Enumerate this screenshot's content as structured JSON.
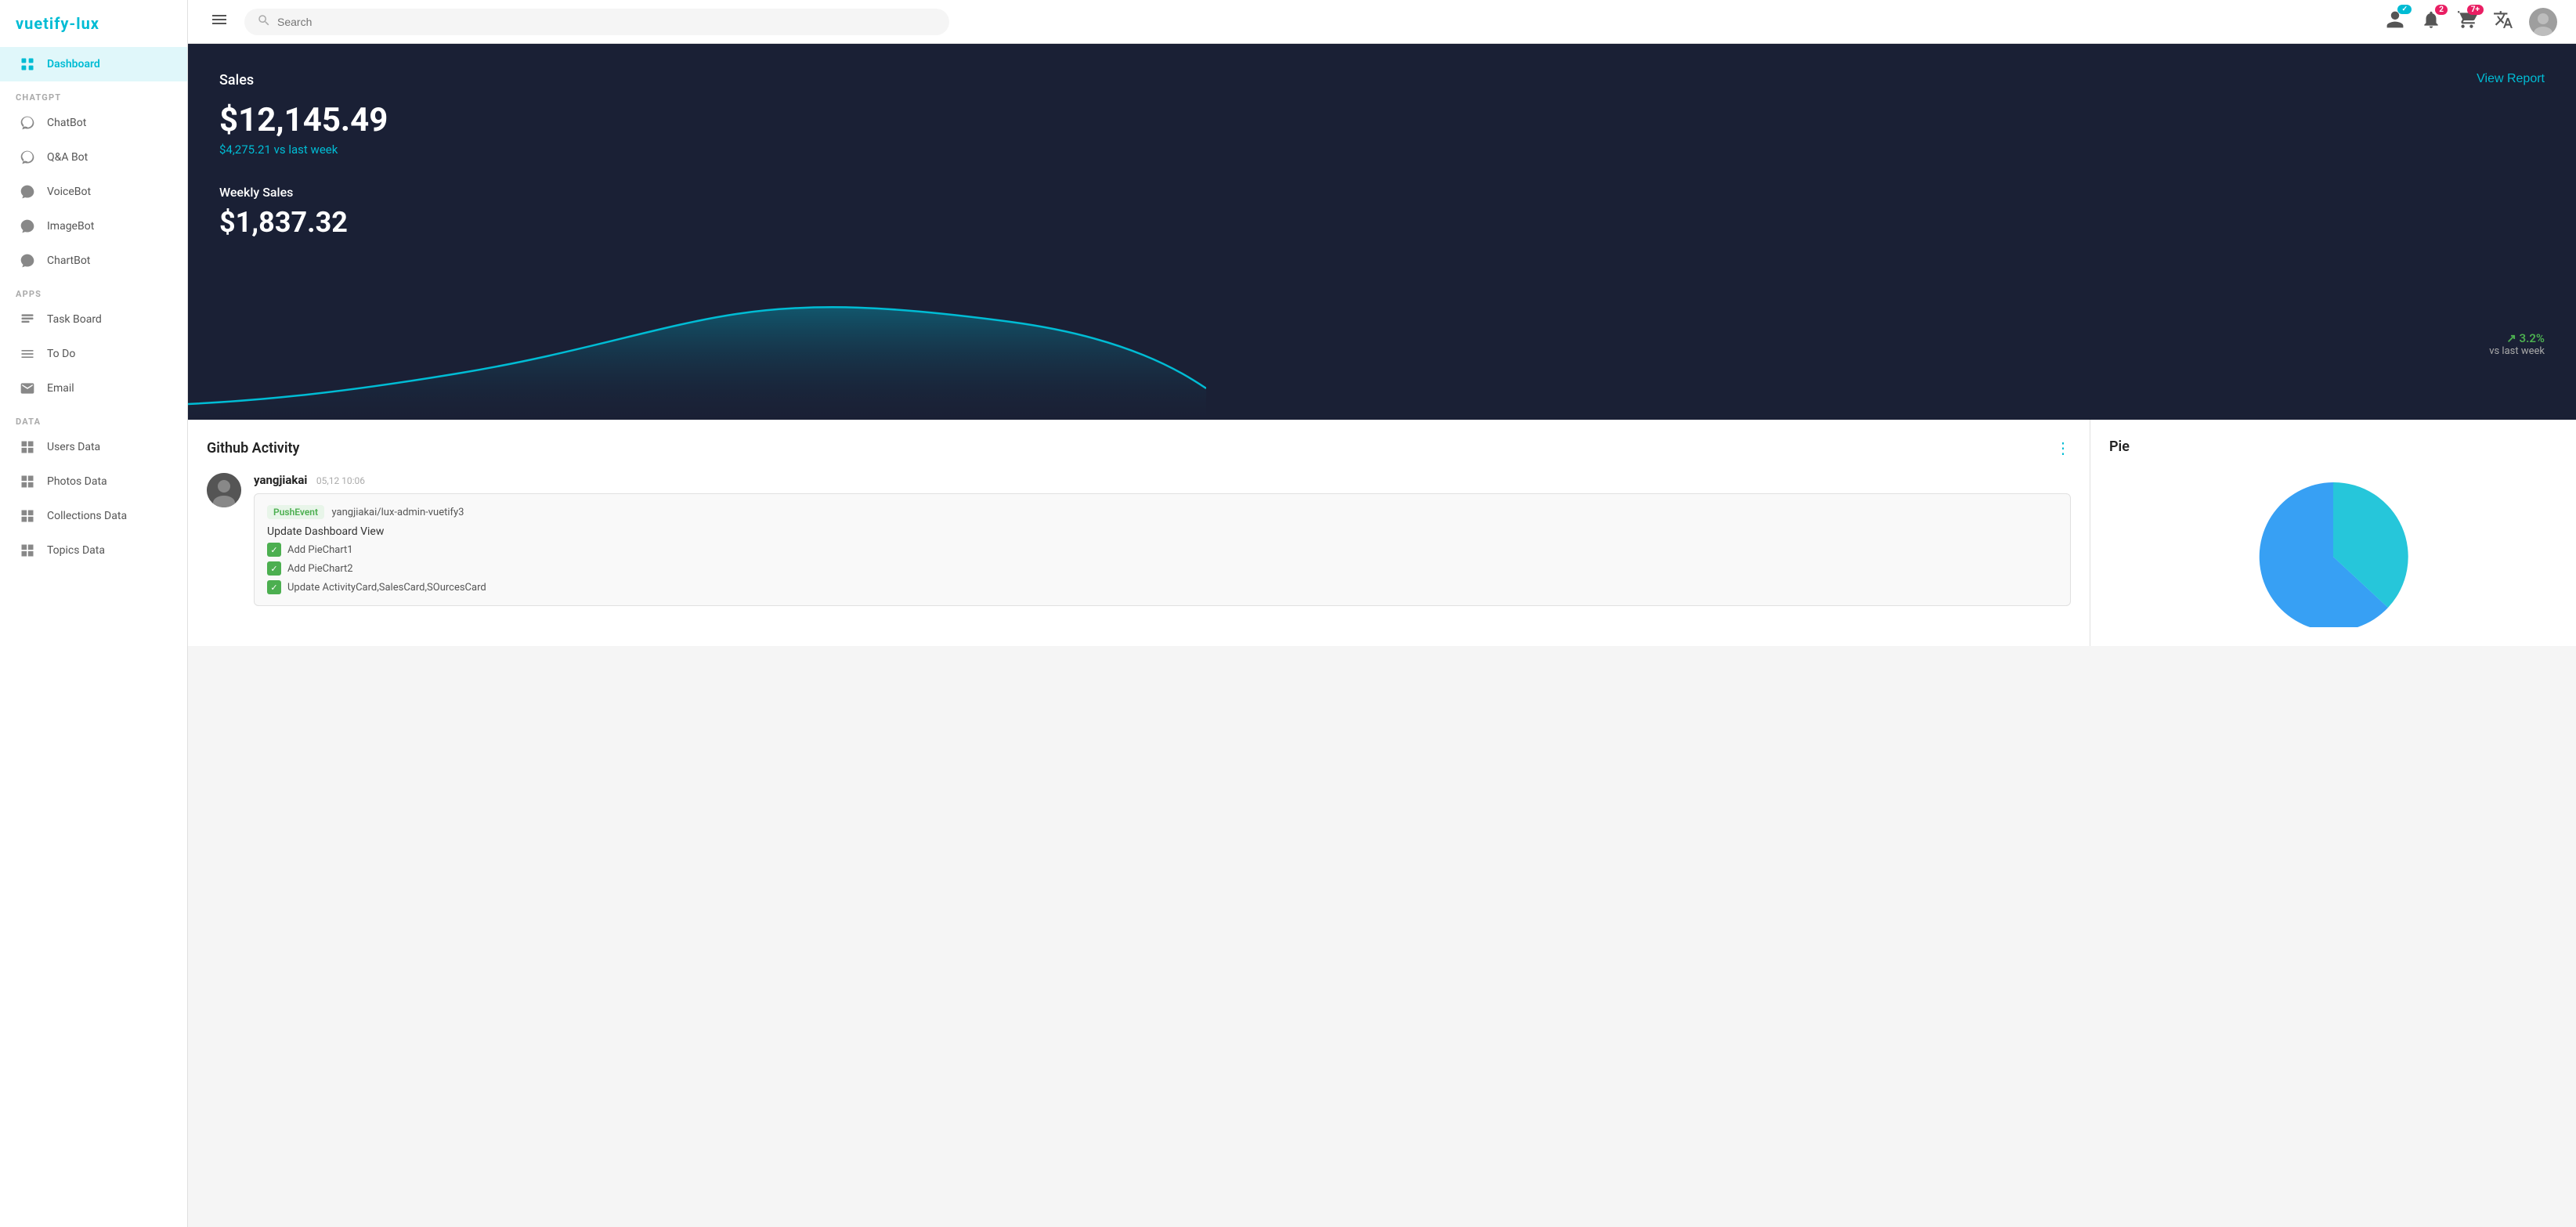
{
  "logo": {
    "text_main": "vuetify",
    "text_accent": "-lux"
  },
  "sidebar": {
    "active_item": "dashboard",
    "dashboard_label": "Dashboard",
    "sections": [
      {
        "id": "chatgpt",
        "label": "CHATGPT",
        "items": [
          {
            "id": "chatbot",
            "label": "ChatBot",
            "icon": "🤖"
          },
          {
            "id": "qabot",
            "label": "Q&A Bot",
            "icon": "🤖"
          },
          {
            "id": "voicebot",
            "label": "VoiceBot",
            "icon": "🤖"
          },
          {
            "id": "imagebot",
            "label": "ImageBot",
            "icon": "🤖"
          },
          {
            "id": "chartbot",
            "label": "ChartBot",
            "icon": "🤖"
          }
        ]
      },
      {
        "id": "apps",
        "label": "APPS",
        "items": [
          {
            "id": "taskboard",
            "label": "Task Board",
            "icon": "📋"
          },
          {
            "id": "todo",
            "label": "To Do",
            "icon": "☰"
          },
          {
            "id": "email",
            "label": "Email",
            "icon": "✉"
          }
        ]
      },
      {
        "id": "data",
        "label": "DATA",
        "items": [
          {
            "id": "usersdata",
            "label": "Users Data",
            "icon": "⊞"
          },
          {
            "id": "photosdata",
            "label": "Photos Data",
            "icon": "⊞"
          },
          {
            "id": "collectionsdata",
            "label": "Collections Data",
            "icon": "⊞"
          },
          {
            "id": "topicsdata",
            "label": "Topics Data",
            "icon": "⊞"
          }
        ]
      }
    ]
  },
  "topbar": {
    "search_placeholder": "Search",
    "notification_badge": "2",
    "cart_badge": "7+",
    "menu_icon": "☰",
    "search_icon": "🔍"
  },
  "sales_card": {
    "title": "Sales",
    "amount": "$12,145.49",
    "vs_last_week": "$4,275.21 vs last week",
    "weekly_label": "Weekly Sales",
    "weekly_amount": "$1,837.32",
    "change_percent": "↗ 3.2%",
    "change_label": "vs last week",
    "view_report": "View Report"
  },
  "github_card": {
    "title": "Github Activity",
    "user": "yangjiakai",
    "timestamp": "05,12 10:06",
    "event_type": "PushEvent",
    "repo": "yangjiakai/lux-admin-vuetify3",
    "commit_message": "Update Dashboard View",
    "checklist": [
      "Add PieChart1",
      "Add PieChart2",
      "Update ActivityCard,SalesCard,SOurcesCard"
    ]
  },
  "pie_card": {
    "title": "Pie"
  },
  "colors": {
    "primary": "#00bcd4",
    "dark_bg": "#1a2035",
    "success": "#4caf50",
    "danger": "#e91e63"
  }
}
